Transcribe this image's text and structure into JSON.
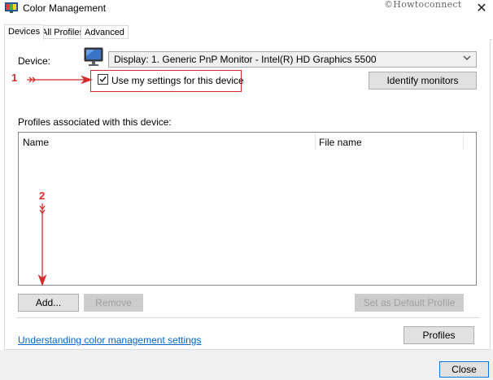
{
  "window": {
    "title": "Color Management",
    "watermark": "©Howtoconnect",
    "close_glyph": "✕",
    "icons": {
      "app": "color-management-icon",
      "monitor": "monitor-icon"
    }
  },
  "tabs": [
    {
      "label": "Devices",
      "selected": true
    },
    {
      "label": "All Profiles",
      "selected": false
    },
    {
      "label": "Advanced",
      "selected": false
    }
  ],
  "device": {
    "label": "Device:",
    "selected": "Display: 1. Generic PnP Monitor - Intel(R) HD Graphics 5500",
    "use_settings_label": "Use my settings for this device",
    "use_settings_checked": true,
    "identify_label": "Identify monitors"
  },
  "profiles": {
    "section_label": "Profiles associated with this device:",
    "columns": [
      "Name",
      "File name"
    ],
    "rows": []
  },
  "buttons": {
    "add": "Add...",
    "remove": "Remove",
    "set_default": "Set as Default Profile",
    "profiles": "Profiles",
    "close": "Close"
  },
  "link": "Understanding color management settings",
  "annotations": {
    "one": "1",
    "two": "2",
    "color": "#d62a2a"
  }
}
